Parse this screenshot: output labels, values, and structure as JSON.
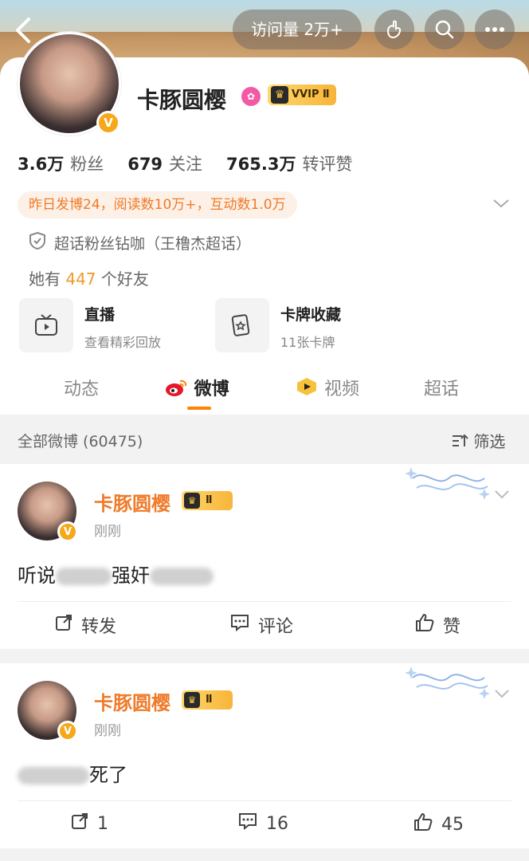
{
  "header": {
    "visits_label": "访问量 2万+",
    "icons": [
      "back-icon",
      "hand-heart-icon",
      "search-icon",
      "more-icon"
    ]
  },
  "profile": {
    "name": "卡豚圆樱",
    "vip_label": "VVIP Ⅱ",
    "stats": [
      {
        "value": "3.6万",
        "label": "粉丝"
      },
      {
        "value": "679",
        "label": "关注"
      },
      {
        "value": "765.3万",
        "label": "转评赞"
      }
    ],
    "summary": "昨日发博24，阅读数10万+，互动数1.0万",
    "super_topic": "超话粉丝钻咖（王橹杰超话）",
    "friends_prefix": "她有",
    "friends_count": "447",
    "friends_suffix": "个好友",
    "tiles": [
      {
        "title": "直播",
        "subtitle": "查看精彩回放"
      },
      {
        "title": "卡牌收藏",
        "subtitle": "11张卡牌"
      }
    ]
  },
  "tabs": [
    "动态",
    "微博",
    "视频",
    "超话"
  ],
  "active_tab": "微博",
  "feed": {
    "all_label": "全部微博 (60475)",
    "filter_label": "筛选"
  },
  "posts": [
    {
      "name": "卡豚圆樱",
      "vip": "Ⅱ",
      "time": "刚刚",
      "text_visible_1": "听说",
      "text_visible_2": "强奸",
      "actions": [
        "转发",
        "评论",
        "赞"
      ]
    },
    {
      "name": "卡豚圆樱",
      "vip": "Ⅱ",
      "time": "刚刚",
      "text_visible": "死了",
      "actions": [
        "1",
        "16",
        "45"
      ]
    }
  ],
  "colors": {
    "accent": "#ff8200",
    "name_orange": "#ef7b2a",
    "summary_bg": "#fdf0e6"
  }
}
